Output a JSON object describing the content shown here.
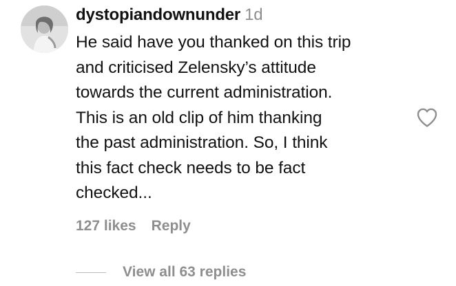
{
  "comment": {
    "username": "dystopiandownunder",
    "timestamp": "1d",
    "text_lines": [
      "He said have you thanked on this trip",
      "and criticised Zelensky’s attitude",
      "towards the current administration.",
      "This is an old clip of him thanking",
      "the past administration. So, I think",
      "this fact check needs to be fact",
      "checked..."
    ],
    "likes": "127 likes",
    "reply_label": "Reply",
    "view_replies_label": "View all 63 replies",
    "avatar_icon": "profile-photo",
    "like_icon": "heart-outline-icon"
  },
  "colors": {
    "text": "#111111",
    "secondary": "#8e8e8e",
    "background": "#ffffff"
  }
}
